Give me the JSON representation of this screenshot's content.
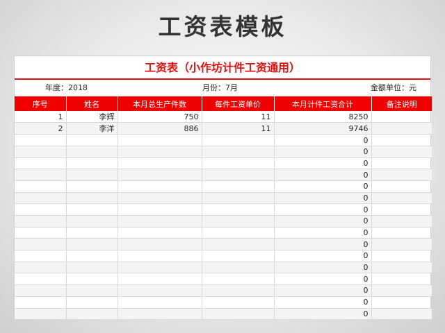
{
  "page_title": "工资表模板",
  "sheet": {
    "title": "工资表（小作坊计件工资通用）",
    "year_label": "年度：2018",
    "month_label": "月份：7月",
    "unit_label": "金额单位：元"
  },
  "columns": [
    "序号",
    "姓名",
    "本月总生产件数",
    "每件工资单价",
    "本月计件工资合计",
    "备注说明"
  ],
  "rows": [
    [
      "1",
      "李辉",
      "750",
      "11",
      "8250",
      ""
    ],
    [
      "2",
      "李洋",
      "886",
      "11",
      "9746",
      ""
    ],
    [
      "",
      "",
      "",
      "",
      "0",
      ""
    ],
    [
      "",
      "",
      "",
      "",
      "0",
      ""
    ],
    [
      "",
      "",
      "",
      "",
      "0",
      ""
    ],
    [
      "",
      "",
      "",
      "",
      "0",
      ""
    ],
    [
      "",
      "",
      "",
      "",
      "0",
      ""
    ],
    [
      "",
      "",
      "",
      "",
      "0",
      ""
    ],
    [
      "",
      "",
      "",
      "",
      "0",
      ""
    ],
    [
      "",
      "",
      "",
      "",
      "0",
      ""
    ],
    [
      "",
      "",
      "",
      "",
      "0",
      ""
    ],
    [
      "",
      "",
      "",
      "",
      "0",
      ""
    ],
    [
      "",
      "",
      "",
      "",
      "0",
      ""
    ],
    [
      "",
      "",
      "",
      "",
      "0",
      ""
    ],
    [
      "",
      "",
      "",
      "",
      "0",
      ""
    ],
    [
      "",
      "",
      "",
      "",
      "0",
      ""
    ],
    [
      "",
      "",
      "",
      "",
      "0",
      ""
    ],
    [
      "",
      "",
      "",
      "",
      "0",
      ""
    ]
  ],
  "colors": {
    "accent": "#f00000",
    "title": "#e01010"
  }
}
